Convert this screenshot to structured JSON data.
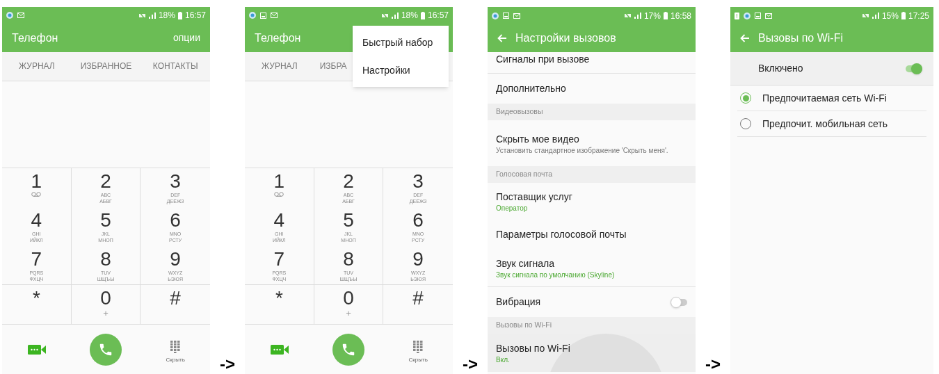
{
  "screens": [
    {
      "kind": "dialer",
      "status_bar": {
        "notifications": [
          {
            "kind": "app"
          },
          {
            "kind": "mail"
          }
        ],
        "battery": "18%",
        "time": "16:57"
      },
      "title": "Телефон",
      "action": "опции",
      "tabs": [
        {
          "label": "ЖУРНАЛ",
          "selected": false
        },
        {
          "label": "ИЗБРАННОЕ",
          "selected": false
        },
        {
          "label": "КОНТАКТЫ",
          "selected": false
        }
      ],
      "keys": [
        {
          "digit": "1",
          "voicemail": true
        },
        {
          "digit": "2",
          "lines": [
            "ABC",
            "АБВГ"
          ]
        },
        {
          "digit": "3",
          "lines": [
            "DEF",
            "ДЕЁЖЗ"
          ]
        },
        {
          "digit": "4",
          "lines": [
            "GHI",
            "ИЙКЛ"
          ]
        },
        {
          "digit": "5",
          "lines": [
            "JKL",
            "МНОП"
          ]
        },
        {
          "digit": "6",
          "lines": [
            "MNO",
            "РСТУ"
          ]
        },
        {
          "digit": "7",
          "lines": [
            "PQRS",
            "ФХЦЧ"
          ]
        },
        {
          "digit": "8",
          "lines": [
            "TUV",
            "ШЩЪЫ"
          ]
        },
        {
          "digit": "9",
          "lines": [
            "WXYZ",
            "ЬЭЮЯ"
          ]
        },
        {
          "digit": "*"
        },
        {
          "digit": "0",
          "lines": [
            "+"
          ]
        },
        {
          "digit": "#"
        }
      ],
      "hide_label": "Скрыть"
    },
    {
      "kind": "dialer",
      "status_bar": {
        "notifications": [
          {
            "kind": "app"
          },
          {
            "kind": "image"
          },
          {
            "kind": "mail"
          }
        ],
        "battery": "18%",
        "time": "16:57"
      },
      "title": "Телефон",
      "tabs": [
        {
          "label": "ЖУРНАЛ",
          "selected": false
        },
        {
          "label": "ИЗБРА",
          "selected": false
        }
      ],
      "menu": [
        "Быстрый набор",
        "Настройки"
      ],
      "keys": [
        {
          "digit": "1",
          "voicemail": true
        },
        {
          "digit": "2",
          "lines": [
            "ABC",
            "АБВГ"
          ]
        },
        {
          "digit": "3",
          "lines": [
            "DEF",
            "ДЕЁЖЗ"
          ]
        },
        {
          "digit": "4",
          "lines": [
            "GHI",
            "ИЙКЛ"
          ]
        },
        {
          "digit": "5",
          "lines": [
            "JKL",
            "МНОП"
          ]
        },
        {
          "digit": "6",
          "lines": [
            "MNO",
            "РСТУ"
          ]
        },
        {
          "digit": "7",
          "lines": [
            "PQRS",
            "ФХЦЧ"
          ]
        },
        {
          "digit": "8",
          "lines": [
            "TUV",
            "ШЩЪЫ"
          ]
        },
        {
          "digit": "9",
          "lines": [
            "WXYZ",
            "ЬЭЮЯ"
          ]
        },
        {
          "digit": "*"
        },
        {
          "digit": "0",
          "lines": [
            "+"
          ]
        },
        {
          "digit": "#"
        }
      ],
      "hide_label": "Скрыть"
    },
    {
      "kind": "settings",
      "status_bar": {
        "notifications": [
          {
            "kind": "app"
          },
          {
            "kind": "image"
          },
          {
            "kind": "mail"
          }
        ],
        "battery": "17%",
        "time": "16:58"
      },
      "title": "Настройки вызовов",
      "items": [
        {
          "kind": "top",
          "title": "Сигналы при вызове"
        },
        {
          "kind": "item",
          "title": "Дополнительно"
        },
        {
          "kind": "header",
          "title": "Видеовызовы"
        },
        {
          "kind": "item",
          "title": "Скрыть мое видео",
          "subtitle": "Установить стандартное изображение 'Скрыть меня'.",
          "accent": false
        },
        {
          "kind": "header",
          "title": "Голосовая почта"
        },
        {
          "kind": "item",
          "title": "Поставщик услуг",
          "subtitle": "Оператор",
          "accent": true
        },
        {
          "kind": "item",
          "title": "Параметры голосовой почты"
        },
        {
          "kind": "item",
          "title": "Звук сигнала",
          "subtitle": "Звук сигнала по умолчанию (Skyline)",
          "accent": true
        },
        {
          "kind": "toggle",
          "title": "Вибрация",
          "on": false
        },
        {
          "kind": "header",
          "title": "Вызовы по Wi-Fi"
        },
        {
          "kind": "item",
          "title": "Вызовы по Wi-Fi",
          "subtitle": "Вкл.",
          "accent": true,
          "pressed": true
        }
      ]
    },
    {
      "kind": "wifi",
      "status_bar": {
        "notifications": [
          {
            "kind": "alert"
          },
          {
            "kind": "app"
          },
          {
            "kind": "image"
          },
          {
            "kind": "mail"
          }
        ],
        "battery": "15%",
        "time": "17:25"
      },
      "title": "Вызовы по Wi-Fi",
      "master": {
        "label": "Включено",
        "on": true
      },
      "options": [
        {
          "label": "Предпочитаемая сеть Wi-Fi",
          "selected": true
        },
        {
          "label": "Предпочит. мобильная сеть",
          "selected": false
        }
      ]
    }
  ],
  "arrows": [
    "->",
    "->",
    "->"
  ]
}
